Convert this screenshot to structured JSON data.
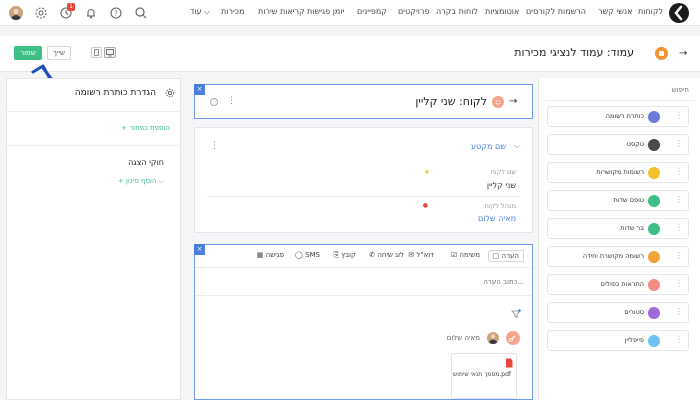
{
  "nav": {
    "items": [
      "לקוחות",
      "אנשי קשר",
      "הרשמות לקורסים",
      "אוטומציות",
      "לוחות בקרה",
      "פרויקטים",
      "קמפיינים",
      "יומן פגישות",
      "קריאות שירות",
      "מכירות",
      "עוד"
    ],
    "notification_count": "1"
  },
  "header": {
    "title": "עמוד: עמוד לנציגי מכירות",
    "save_label": "שמור",
    "share_label": "שייך"
  },
  "left_panel": {
    "title": "הגדרת כותרת רשומה",
    "add_button": "+ הוספת כפתור",
    "display_rules": "חוקי הצגה",
    "add_filter": "+ הוסף סינון ⌵"
  },
  "customer_card": {
    "title": "לקוח: שני קליין"
  },
  "section_card": {
    "section_name": "שם מקטע",
    "fields": [
      {
        "label": "שם לקוח",
        "value": "שני קליין"
      },
      {
        "label": "מנהל לקוח",
        "value": "מאיה שלום"
      }
    ]
  },
  "activity_card": {
    "tabs": [
      "הערה",
      "משימה",
      "דוא\"ל",
      "לוג שיחה",
      "קובץ",
      "SMS",
      "פגישה"
    ],
    "note_placeholder": "כתוב הערה...",
    "author": "מאיה שלום",
    "attachment": "מסמך תנאי שימוש.pdf"
  },
  "sidebar": {
    "search_placeholder": "חיפוש",
    "widgets": [
      {
        "label": "כותרת רשומה",
        "color": "#6c7bd9"
      },
      {
        "label": "טקסט",
        "color": "#4a4a4a"
      },
      {
        "label": "רשומות מקושרות",
        "color": "#f2c12e"
      },
      {
        "label": "טופס שדות",
        "color": "#3dbf86"
      },
      {
        "label": "בר שדות",
        "color": "#3dbf86"
      },
      {
        "label": "רשומה מקושרת יחידה",
        "color": "#f2a33a"
      },
      {
        "label": "התראות כפולים",
        "color": "#f28b82"
      },
      {
        "label": "סטורים",
        "color": "#9c6ad9"
      },
      {
        "label": "פייפליין",
        "color": "#6cc2f2"
      }
    ]
  }
}
